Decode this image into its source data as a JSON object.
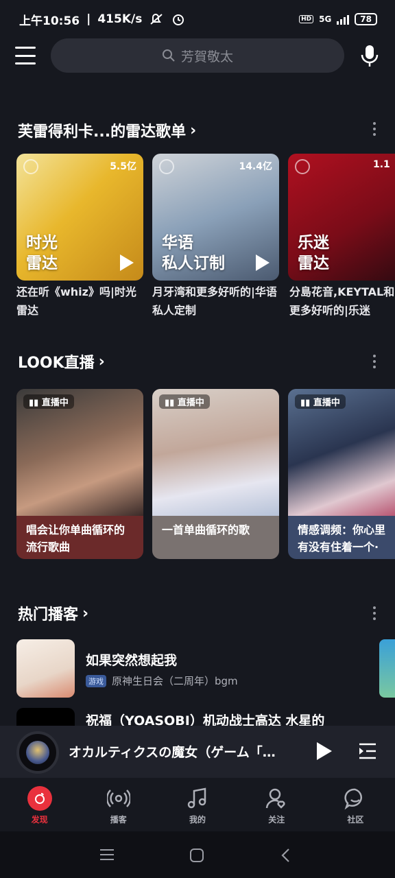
{
  "status": {
    "time": "上午10:56",
    "speed": "415K/s",
    "network": "5G",
    "hd": "HD",
    "battery": "78"
  },
  "search": {
    "placeholder": "芳賀敬太"
  },
  "radar": {
    "title": "芙雷得利卡...的雷达歌单",
    "cards": [
      {
        "count": "5.5亿",
        "line1": "时光",
        "line2": "雷达",
        "desc": "还在听《whiz》吗|时光雷达"
      },
      {
        "count": "14.4亿",
        "line1": "华语",
        "line2": "私人订制",
        "desc": "月牙湾和更多好听的|华语私人定制"
      },
      {
        "count": "1.1",
        "line1": "乐迷",
        "line2": "雷达",
        "desc": "分島花音,KEYTAL和更多好听的|乐迷"
      }
    ]
  },
  "look": {
    "title": "LOOK直播",
    "cards": [
      {
        "tag": "直播中",
        "caption": "唱会让你单曲循环的流行歌曲"
      },
      {
        "tag": "直播中",
        "caption": "一首单曲循环的歌"
      },
      {
        "tag": "直播中",
        "caption": "情感调频：你心里有没有住着一个·"
      }
    ]
  },
  "podcast": {
    "title": "热门播客",
    "items": [
      {
        "title": "如果突然想起我",
        "tag": "游戏",
        "subtitle": "原神生日会（二周年）bgm"
      },
      {
        "title": "祝福（YOASOBI）机动战士高达 水星的",
        "tag": "",
        "subtitle": ""
      }
    ]
  },
  "player": {
    "title": "オカルティクスの魔女（ゲーム「…"
  },
  "tabs": [
    {
      "label": "发现",
      "icon": "netease-logo-icon"
    },
    {
      "label": "播客",
      "icon": "podcast-icon"
    },
    {
      "label": "我的",
      "icon": "music-note-icon"
    },
    {
      "label": "关注",
      "icon": "follow-user-icon"
    },
    {
      "label": "社区",
      "icon": "community-chat-icon"
    }
  ],
  "colors": {
    "accent": "#e9313d",
    "background": "#16181f",
    "card_live1": "#6b2a2a",
    "card_live2": "#7a7270",
    "card_live3": "#3b4a6b"
  }
}
